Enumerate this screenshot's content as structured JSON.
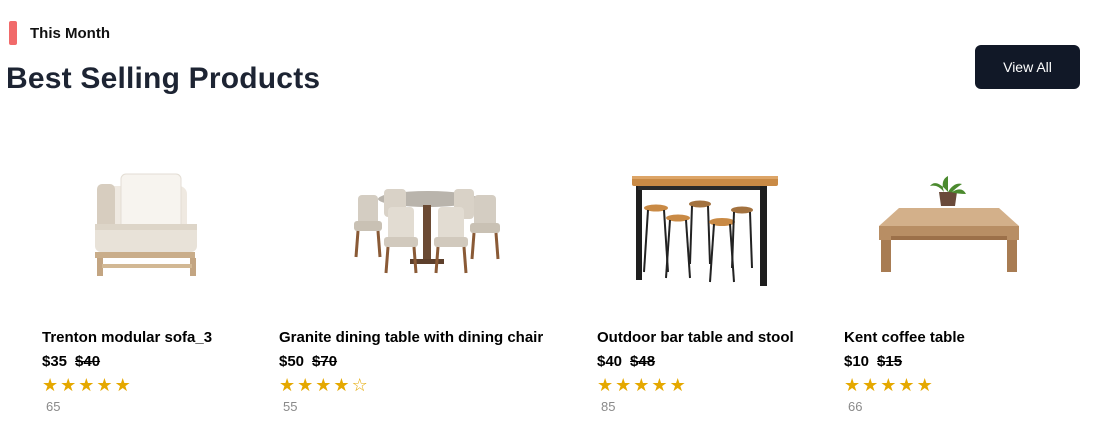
{
  "section": {
    "tag": "This Month",
    "title": "Best Selling Products",
    "view_all_label": "View All"
  },
  "colors": {
    "tag_bar": "#f16a6a",
    "button_bg": "#111827",
    "star": "#e5a800"
  },
  "products": [
    {
      "name": "Trenton modular sofa_3",
      "price": "$35",
      "old_price": "$40",
      "rating": 5,
      "reviews": "65",
      "image": "modular-sofa"
    },
    {
      "name": "Granite dining table with dining chair",
      "price": "$50",
      "old_price": "$70",
      "rating": 4,
      "reviews": "55",
      "image": "dining-set"
    },
    {
      "name": "Outdoor bar table and stool",
      "price": "$40",
      "old_price": "$48",
      "rating": 5,
      "reviews": "85",
      "image": "bar-table"
    },
    {
      "name": "Kent coffee table",
      "price": "$10",
      "old_price": "$15",
      "rating": 5,
      "reviews": "66",
      "image": "coffee-table"
    }
  ]
}
